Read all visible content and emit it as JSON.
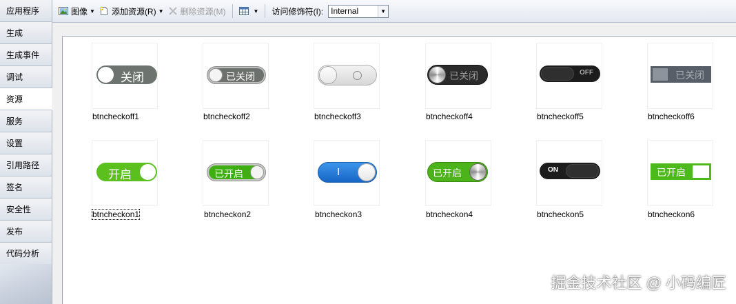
{
  "sidebar": {
    "items": [
      {
        "label": "应用程序",
        "active": false
      },
      {
        "label": "生成",
        "active": false
      },
      {
        "label": "生成事件",
        "active": false
      },
      {
        "label": "调试",
        "active": false
      },
      {
        "label": "资源",
        "active": true
      },
      {
        "label": "服务",
        "active": false
      },
      {
        "label": "设置",
        "active": false
      },
      {
        "label": "引用路径",
        "active": false
      },
      {
        "label": "签名",
        "active": false
      },
      {
        "label": "安全性",
        "active": false
      },
      {
        "label": "发布",
        "active": false
      },
      {
        "label": "代码分析",
        "active": false
      }
    ]
  },
  "toolbar": {
    "images_label": "图像",
    "add_resource_label": "添加资源(R)",
    "remove_resource_label": "删除资源(M)",
    "access_modifier_label": "访问修饰符(I):",
    "access_modifier_value": "Internal"
  },
  "resources": {
    "off": [
      {
        "name": "btncheckoff1",
        "text": "关闭"
      },
      {
        "name": "btncheckoff2",
        "text": "已关闭"
      },
      {
        "name": "btncheckoff3",
        "text": ""
      },
      {
        "name": "btncheckoff4",
        "text": "已关闭"
      },
      {
        "name": "btncheckoff5",
        "text": "OFF"
      },
      {
        "name": "btncheckoff6",
        "text": "已关闭"
      }
    ],
    "on": [
      {
        "name": "btncheckon1",
        "text": "开启"
      },
      {
        "name": "btncheckon2",
        "text": "已开启"
      },
      {
        "name": "btncheckon3",
        "text": "I"
      },
      {
        "name": "btncheckon4",
        "text": "已开启"
      },
      {
        "name": "btncheckon5",
        "text": "ON"
      },
      {
        "name": "btncheckon6",
        "text": "已开启"
      }
    ]
  },
  "colors": {
    "accent_green": "#5bbf1e",
    "accent_blue": "#1f78d8",
    "gray_dark": "#6d7470"
  },
  "watermark": "掘金技术社区 @ 小码编匠"
}
